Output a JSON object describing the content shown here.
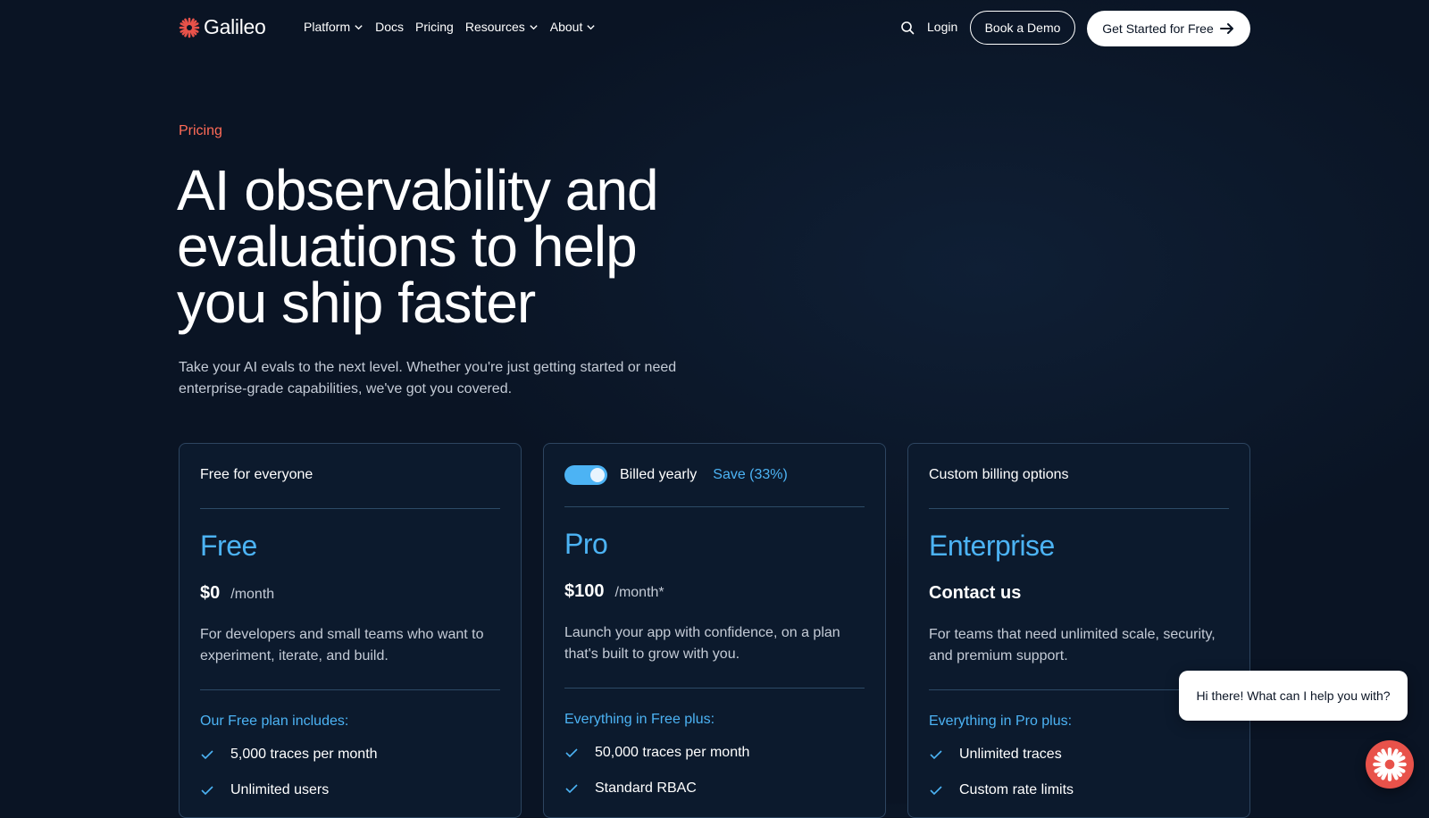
{
  "brand": {
    "name": "Galileo",
    "color": "#e8524a"
  },
  "nav": {
    "links": [
      {
        "label": "Platform",
        "has_dropdown": true
      },
      {
        "label": "Docs",
        "has_dropdown": false
      },
      {
        "label": "Pricing",
        "has_dropdown": false
      },
      {
        "label": "Resources",
        "has_dropdown": true
      },
      {
        "label": "About",
        "has_dropdown": true
      }
    ],
    "search_icon": "search-icon",
    "login": "Login",
    "book_demo": "Book a Demo",
    "get_started": "Get Started for Free"
  },
  "hero": {
    "eyebrow": "Pricing",
    "title": "AI observability and evaluations to help you ship faster",
    "subtitle": "Take your AI evals to the next level. Whether you're just getting started or need enterprise-grade capabilities, we've got you covered."
  },
  "plans": {
    "free": {
      "top": "Free for everyone",
      "name": "Free",
      "price": "$0",
      "unit": "/month",
      "desc": "For developers and small teams who want to experiment, iterate, and build.",
      "includes": "Our Free plan includes:",
      "features": [
        "5,000 traces per month",
        "Unlimited users"
      ]
    },
    "pro": {
      "billing_label": "Billed yearly",
      "save_label": "Save (33%)",
      "billed_yearly": true,
      "name": "Pro",
      "price": "$100",
      "unit": "/month*",
      "desc": "Launch your app with confidence, on a plan that's built to grow with you.",
      "includes": "Everything in Free plus:",
      "features": [
        "50,000 traces per month",
        "Standard RBAC"
      ]
    },
    "enterprise": {
      "top": "Custom billing options",
      "name": "Enterprise",
      "contact": "Contact us",
      "desc": "For teams that need unlimited scale, security, and premium support.",
      "includes": "Everything in Pro plus:",
      "features": [
        "Unlimited traces",
        "Custom rate limits"
      ]
    }
  },
  "chat": {
    "greeting": "Hi there! What can I help you with?"
  },
  "colors": {
    "background": "#0a1424",
    "accent": "#4cb3f4",
    "eyebrow": "#ff6b57"
  }
}
